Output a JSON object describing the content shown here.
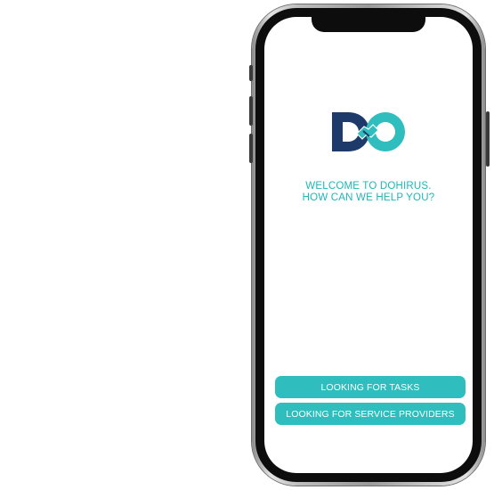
{
  "brand": {
    "logo_alt": "DO",
    "colors": {
      "navy": "#1d3a6b",
      "teal": "#2fbdbd",
      "text_teal": "#1fb6b6"
    }
  },
  "welcome": {
    "line1": "WELCOME TO DOHIRUS.",
    "line2": "HOW CAN WE HELP YOU?"
  },
  "actions": {
    "tasks_label": "LOOKING FOR TASKS",
    "providers_label": "LOOKING FOR SERVICE PROVIDERS"
  },
  "icons": {
    "logo": "dohirus-logo-icon",
    "handshake": "handshake-icon"
  }
}
